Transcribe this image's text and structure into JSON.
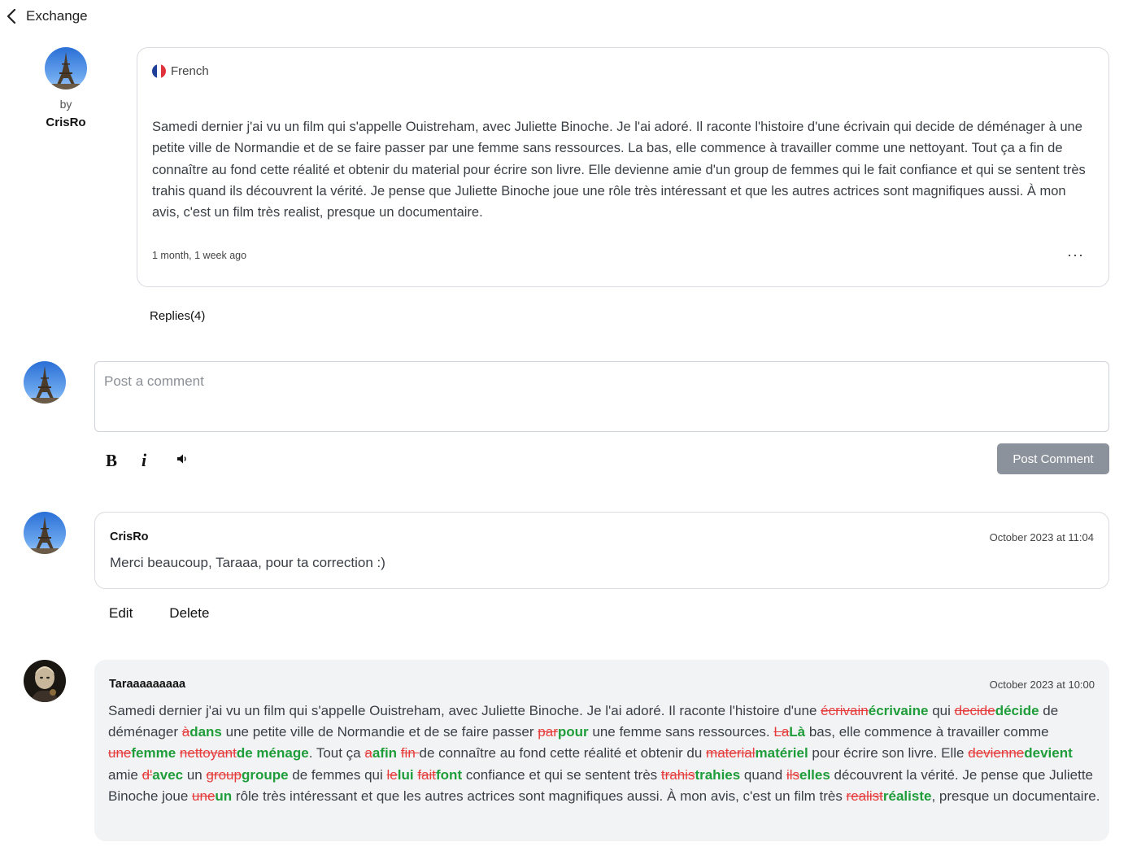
{
  "header": {
    "back_label": "Exchange"
  },
  "post": {
    "by_label": "by",
    "author": "CrisRo",
    "language": "French",
    "text": "Samedi dernier j'ai vu un film qui s'appelle Ouistreham, avec Juliette Binoche. Je l'ai adoré. Il raconte l'histoire d'une écrivain qui decide de déménager à une petite ville de Normandie et de se faire passer par une femme sans ressources. La bas, elle commence à travailler comme une nettoyant. Tout ça a fin de connaître au fond cette réalité et obtenir du material pour écrire son livre. Elle devienne amie d'un group de femmes qui le fait confiance et qui se sentent très trahis quand ils découvrent la vérité. Je pense que Juliette Binoche joue une rôle très intéressant et que les autres actrices sont magnifiques aussi. À mon avis, c'est un film très realist, presque un documentaire.",
    "time": "1 month, 1 week ago",
    "more_label": "···",
    "replies_label": "Replies(4)"
  },
  "composer": {
    "placeholder": "Post a comment",
    "bold_label": "B",
    "italic_label": "i",
    "post_button": "Post Comment"
  },
  "replies": [
    {
      "author": "CrisRo",
      "time": "October 2023 at 11:04",
      "text": "Merci beaucoup, Taraaa, pour ta correction :)",
      "edit_label": "Edit",
      "delete_label": "Delete"
    },
    {
      "author": "Taraaaaaaaaa",
      "time": "October 2023 at 10:00",
      "segments": [
        {
          "t": "Samedi dernier j'ai vu un film qui s'appelle Ouistreham, avec Juliette Binoche. Je l'ai adoré. Il raconte l'histoire d'une "
        },
        {
          "t": "écrivain",
          "k": "del"
        },
        {
          "t": "écrivaine",
          "k": "ins"
        },
        {
          "t": " qui "
        },
        {
          "t": "decide",
          "k": "del"
        },
        {
          "t": "décide",
          "k": "ins"
        },
        {
          "t": " de déménager "
        },
        {
          "t": "à",
          "k": "del"
        },
        {
          "t": "dans",
          "k": "ins"
        },
        {
          "t": " une petite ville de Normandie et de se faire passer "
        },
        {
          "t": "par",
          "k": "del"
        },
        {
          "t": "pour",
          "k": "ins"
        },
        {
          "t": " une femme sans ressources. "
        },
        {
          "t": "La",
          "k": "del"
        },
        {
          "t": "Là",
          "k": "ins"
        },
        {
          "t": " bas, elle commence à travailler comme "
        },
        {
          "t": "une",
          "k": "del"
        },
        {
          "t": "femme",
          "k": "ins"
        },
        {
          "t": " "
        },
        {
          "t": "nettoyant",
          "k": "del"
        },
        {
          "t": "de ménage",
          "k": "ins"
        },
        {
          "t": ". Tout ça "
        },
        {
          "t": "a",
          "k": "del"
        },
        {
          "t": "afin",
          "k": "ins"
        },
        {
          "t": " "
        },
        {
          "t": "fin ",
          "k": "del"
        },
        {
          "t": "de connaître au fond cette réalité et obtenir du "
        },
        {
          "t": "material",
          "k": "del"
        },
        {
          "t": "matériel",
          "k": "ins"
        },
        {
          "t": " pour écrire son livre. Elle "
        },
        {
          "t": "devienne",
          "k": "del"
        },
        {
          "t": "devient",
          "k": "ins"
        },
        {
          "t": " amie "
        },
        {
          "t": "d'",
          "k": "del"
        },
        {
          "t": "avec",
          "k": "ins"
        },
        {
          "t": " un "
        },
        {
          "t": "group",
          "k": "del"
        },
        {
          "t": "groupe",
          "k": "ins"
        },
        {
          "t": " de femmes qui "
        },
        {
          "t": "le",
          "k": "del"
        },
        {
          "t": "lui",
          "k": "ins"
        },
        {
          "t": " "
        },
        {
          "t": "fait",
          "k": "del"
        },
        {
          "t": "font",
          "k": "ins"
        },
        {
          "t": " confiance et qui se sentent très "
        },
        {
          "t": "trahis",
          "k": "del"
        },
        {
          "t": "trahies",
          "k": "ins"
        },
        {
          "t": " quand "
        },
        {
          "t": "ils",
          "k": "del"
        },
        {
          "t": "elles",
          "k": "ins"
        },
        {
          "t": " découvrent la vérité. Je pense que Juliette Binoche joue "
        },
        {
          "t": "une",
          "k": "del"
        },
        {
          "t": "un",
          "k": "ins"
        },
        {
          "t": " rôle très intéressant et que les autres actrices sont magnifiques aussi. À mon avis, c'est un film très "
        },
        {
          "t": "realist",
          "k": "del"
        },
        {
          "t": "réaliste",
          "k": "ins"
        },
        {
          "t": ", presque un documentaire."
        }
      ]
    }
  ],
  "colors": {
    "deleted": "#e63b3b",
    "inserted": "#1f9d3a",
    "button": "#8c929b"
  },
  "icons": [
    "chevron-left-icon",
    "french-flag-icon",
    "eiffel-tower-avatar",
    "audio-icon"
  ]
}
